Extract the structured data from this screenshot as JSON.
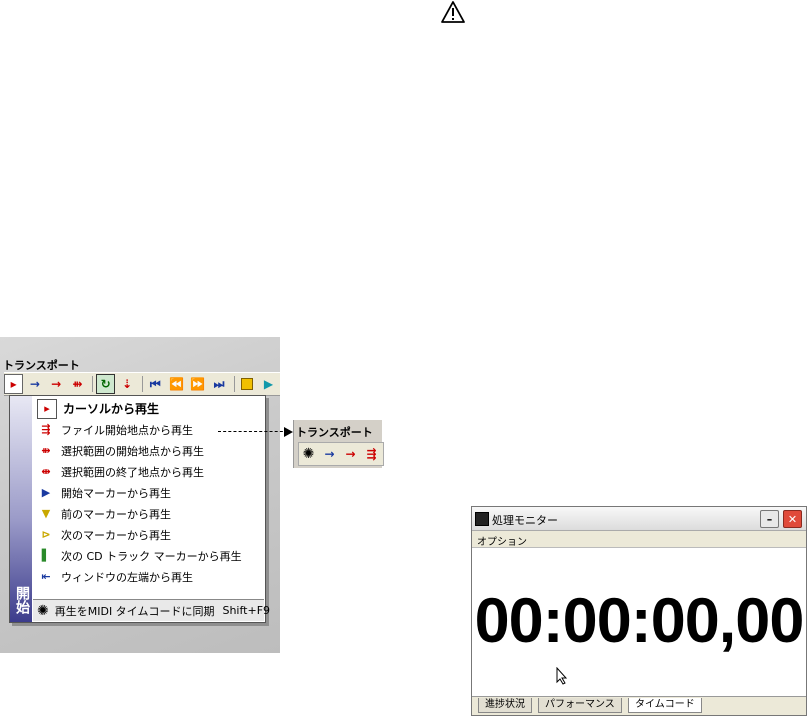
{
  "warning_icon": "warning-icon",
  "transport": {
    "title": "トランスポート",
    "toolbar_icons": [
      "play-from-cursor-icon",
      "play-arrow-icon",
      "play-red-icon",
      "play-region-icon",
      "loop-icon",
      "cursor-icon",
      "go-start-icon",
      "rewind-icon",
      "fast-forward-icon",
      "go-end-icon",
      "stop-icon",
      "play-icon"
    ]
  },
  "menu": {
    "side_label": "開始",
    "items": [
      {
        "label": "カーソルから再生",
        "bold": true
      },
      {
        "label": "ファイル開始地点から再生"
      },
      {
        "label": "選択範囲の開始地点から再生"
      },
      {
        "label": "選択範囲の終了地点から再生"
      },
      {
        "label": "開始マーカーから再生"
      },
      {
        "label": "前のマーカーから再生"
      },
      {
        "label": "次のマーカーから再生"
      },
      {
        "label": "次の CD トラック マーカーから再生"
      },
      {
        "label": "ウィンドウの左端から再生"
      }
    ],
    "sync_item": {
      "label": "再生をMIDI タイムコードに同期",
      "shortcut": "Shift+F9"
    }
  },
  "mini_transport": {
    "title": "トランスポート"
  },
  "monitor": {
    "title": "処理モニター",
    "menu_option": "オプション",
    "time": "00:00:00,00",
    "tabs": [
      "進捗状況",
      "パフォーマンス",
      "タイムコード"
    ],
    "active_tab": "タイムコード"
  }
}
